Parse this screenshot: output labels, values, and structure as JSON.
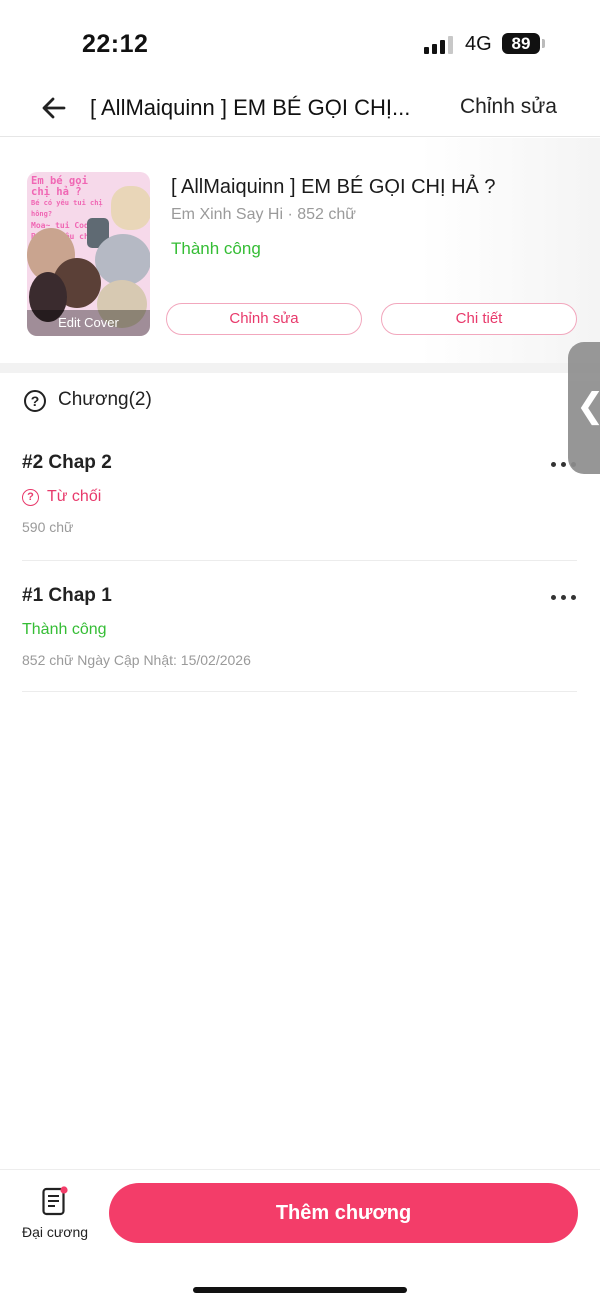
{
  "status_bar": {
    "time": "22:12",
    "network": "4G",
    "battery": "89"
  },
  "header": {
    "title": "[ AllMaiquinn ] EM BÉ GỌI CHỊ...",
    "edit_label": "Chỉnh sửa",
    "back_icon": "arrow-left-icon"
  },
  "book": {
    "title": "[ AllMaiquinn ] EM BÉ GỌI CHỊ HẢ ?",
    "meta": "Em Xinh Say Hi · 852 chữ",
    "status": "Thành công",
    "cover_label": "Edit Cover",
    "cover_text": [
      "Em bé gọi chị hả ?",
      "Bé có yêu tui chị hông?",
      "Moa~ tui Codaa",
      "Bé ơi~Yêu chị"
    ],
    "edit_button": "Chỉnh sửa",
    "detail_button": "Chi tiết"
  },
  "chapters": {
    "heading": "Chương(2)",
    "items": [
      {
        "title": "#2 Chap 2",
        "status": "Từ chối",
        "status_color": "#e8396b",
        "meta": "590 chữ"
      },
      {
        "title": "#1 Chap 1",
        "status": "Thành công",
        "status_color": "#35bd35",
        "meta": "852 chữ Ngày Cập Nhật: 15/02/2026"
      }
    ]
  },
  "side_handle": {
    "glyph": "❮"
  },
  "bottom": {
    "outline_label": "Đại cương",
    "add_button": "Thêm chương"
  },
  "colors": {
    "accent": "#f33d69",
    "success": "#35bd35",
    "reject": "#e8396b"
  }
}
